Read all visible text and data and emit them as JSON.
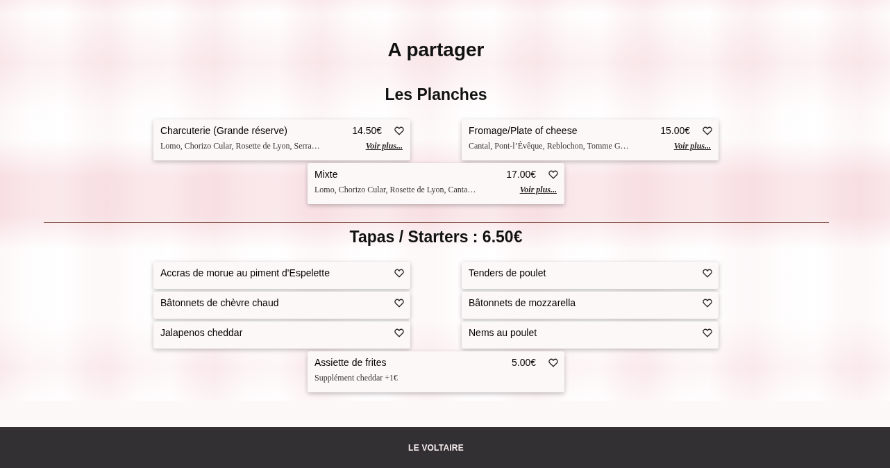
{
  "page": {
    "title": "A partager"
  },
  "sections": [
    {
      "title": "Les Planches",
      "items": [
        {
          "name": "Charcuterie (Grande réserve)",
          "price": "14.50€",
          "description": "Lomo, Chorizo Cular, Rosette de Lyon, Serra…",
          "link": "Voir plus..."
        },
        {
          "name": "Fromage/Plate of cheese",
          "price": "15.00€",
          "description": "Cantal, Pont-l’Évêque, Reblochon, Tomme G…",
          "link": "Voir plus..."
        },
        {
          "name": "Mixte",
          "price": "17.00€",
          "description": "Lomo, Chorizo Cular, Rosette de Lyon, Canta…",
          "link": "Voir plus..."
        }
      ]
    },
    {
      "title": "Tapas / Starters : 6.50€",
      "items": [
        {
          "name": "Accras de morue au piment d'Espelette"
        },
        {
          "name": "Tenders de poulet"
        },
        {
          "name": "Bâtonnets de chèvre chaud"
        },
        {
          "name": "Bâtonnets de mozzarella"
        },
        {
          "name": "Jalapenos cheddar"
        },
        {
          "name": "Nems au poulet"
        },
        {
          "name": "Assiette de frites",
          "price": "5.00€",
          "description": "Supplément cheddar +1€"
        }
      ]
    }
  ],
  "footer": {
    "brand": "LE VOLTAIRE"
  }
}
